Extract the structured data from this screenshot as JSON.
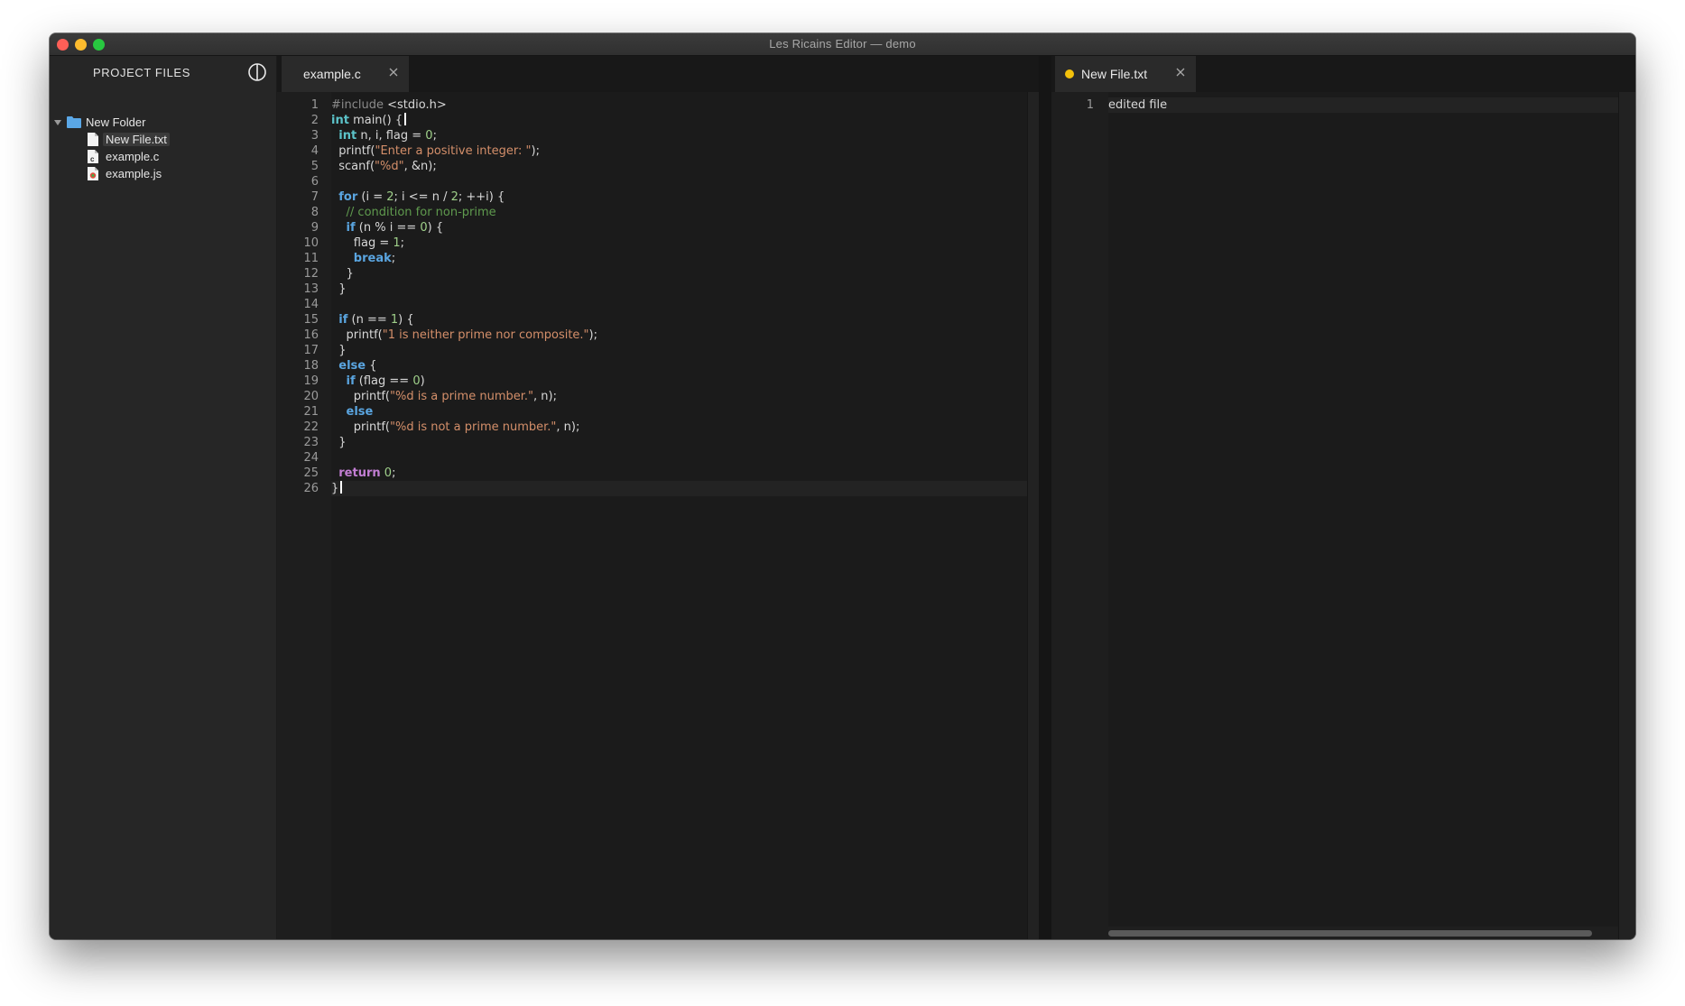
{
  "window": {
    "title": "Les Ricains Editor — demo"
  },
  "sidebar": {
    "title": "PROJECT FILES",
    "folder": {
      "label": "New Folder",
      "expanded": true
    },
    "files": [
      {
        "label": "New File.txt",
        "selected": true,
        "icon": "text-file-icon"
      },
      {
        "label": "example.c",
        "selected": false,
        "icon": "c-file-icon"
      },
      {
        "label": "example.js",
        "selected": false,
        "icon": "js-file-icon"
      }
    ]
  },
  "left_pane": {
    "tab": {
      "label": "example.c"
    },
    "line_numbers": [
      "1",
      "2",
      "3",
      "4",
      "5",
      "6",
      "7",
      "8",
      "9",
      "10",
      "11",
      "12",
      "13",
      "14",
      "15",
      "16",
      "17",
      "18",
      "19",
      "20",
      "21",
      "22",
      "23",
      "24",
      "25",
      "26"
    ],
    "lines": [
      "#include <stdio.h>",
      "int main() {",
      "  int n, i, flag = 0;",
      "  printf(\"Enter a positive integer: \");",
      "  scanf(\"%d\", &n);",
      "",
      "  for (i = 2; i <= n / 2; ++i) {",
      "    // condition for non-prime",
      "    if (n % i == 0) {",
      "      flag = 1;",
      "      break;",
      "    }",
      "  }",
      "",
      "  if (n == 1) {",
      "    printf(\"1 is neither prime nor composite.\");",
      "  }",
      "  else {",
      "    if (flag == 0)",
      "      printf(\"%d is a prime number.\", n);",
      "    else",
      "      printf(\"%d is not a prime number.\", n);",
      "  }",
      "",
      "  return 0;",
      "}"
    ]
  },
  "right_pane": {
    "tab": {
      "label": "New File.txt",
      "modified": true
    },
    "line_numbers": [
      "1"
    ],
    "lines": [
      "edited file"
    ]
  },
  "colors": {
    "keyword": "#5aa5e0",
    "return_keyword": "#c27ed3",
    "type": "#5cc3c9",
    "string": "#d48f6a",
    "number": "#9fd08a",
    "comment": "#5f9a4e",
    "preprocessor": "#8b8b8b",
    "modified_dot": "#f3c10b"
  }
}
